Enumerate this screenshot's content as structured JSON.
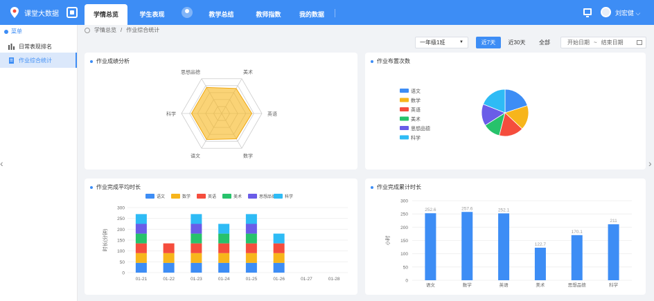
{
  "app": {
    "title": "课堂大数据"
  },
  "topnav": {
    "tabs": [
      {
        "label": "学情总览",
        "active": true
      },
      {
        "label": "学生表现"
      },
      {
        "label": "教学总结"
      },
      {
        "label": "教师指数"
      },
      {
        "label": "我的数据"
      }
    ],
    "user_name": "刘宏健"
  },
  "sidebar": {
    "menu_title": "菜单",
    "items": [
      {
        "label": "日常表现排名",
        "icon": "bar-chart-icon"
      },
      {
        "label": "作业综合统计",
        "icon": "document-icon",
        "active": true
      }
    ]
  },
  "breadcrumb": {
    "root": "学情总览",
    "sep": "/",
    "current": "作业综合统计"
  },
  "filters": {
    "class_select": "一年级1班",
    "ranges": [
      "近7天",
      "近30天",
      "全部"
    ],
    "active_range": "近7天",
    "start_placeholder": "开始日期",
    "range_sep": "~",
    "end_placeholder": "结束日期"
  },
  "colors": {
    "accent": "#3d8df5",
    "yuwen": "#3d8df5",
    "shuxue": "#f7b51b",
    "yingyu": "#f54d3d",
    "meishu": "#27c26b",
    "sixiang": "#6a5ce8",
    "kexue": "#2ebbf5"
  },
  "cards": {
    "radar": {
      "title": "作业成绩分析"
    },
    "pie": {
      "title": "作业布置次数"
    },
    "stacked": {
      "title": "作业完成平均时长"
    },
    "total": {
      "title": "作业完成累计时长"
    }
  },
  "chart_data": [
    {
      "type": "radar",
      "title": "作业成绩分析",
      "indicators": [
        "思想品德",
        "美术",
        "英语",
        "数学",
        "语文",
        "科学"
      ],
      "values": [
        0.75,
        0.72,
        0.75,
        0.73,
        0.75,
        0.75
      ]
    },
    {
      "type": "pie",
      "title": "作业布置次数",
      "legend": [
        "语文",
        "数学",
        "英语",
        "美术",
        "思想品德",
        "科学"
      ],
      "values": [
        20,
        17,
        17,
        12,
        15,
        19
      ]
    },
    {
      "type": "bar",
      "stacked": true,
      "title": "作业完成平均时长",
      "ylabel": "时长(分钟)",
      "ylim": [
        0,
        300
      ],
      "yticks": [
        0,
        50,
        100,
        150,
        200,
        250,
        300
      ],
      "categories": [
        "01-21",
        "01-22",
        "01-23",
        "01-24",
        "01-25",
        "01-26",
        "01-27",
        "01-28"
      ],
      "series": [
        {
          "name": "语文",
          "values": [
            45,
            45,
            45,
            45,
            45,
            45,
            0,
            0
          ]
        },
        {
          "name": "数学",
          "values": [
            45,
            45,
            45,
            45,
            45,
            45,
            0,
            0
          ]
        },
        {
          "name": "英语",
          "values": [
            45,
            45,
            45,
            45,
            45,
            45,
            0,
            0
          ]
        },
        {
          "name": "美术",
          "values": [
            45,
            0,
            45,
            45,
            45,
            0,
            0,
            0
          ]
        },
        {
          "name": "思想品德",
          "values": [
            45,
            0,
            45,
            0,
            45,
            0,
            0,
            0
          ]
        },
        {
          "name": "科学",
          "values": [
            45,
            0,
            45,
            45,
            45,
            45,
            0,
            0
          ]
        }
      ]
    },
    {
      "type": "bar",
      "title": "作业完成累计时长",
      "ylabel": "小时",
      "ylim": [
        0,
        300
      ],
      "yticks": [
        0,
        50,
        100,
        150,
        200,
        250,
        300
      ],
      "categories": [
        "语文",
        "数学",
        "英语",
        "美术",
        "思想品德",
        "科学"
      ],
      "values": [
        252.6,
        257.6,
        252.1,
        122.7,
        170.1,
        211
      ],
      "labels": [
        "252.6",
        "257.6",
        "252.1",
        "122.7",
        "170.1",
        "211"
      ]
    }
  ]
}
